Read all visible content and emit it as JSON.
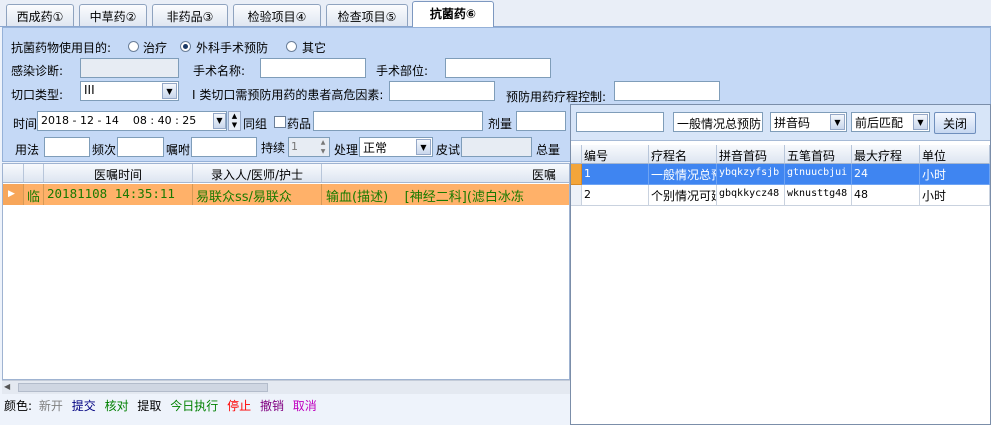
{
  "tabs": [
    "西成药①",
    "中草药②",
    "非药品③",
    "检验项目④",
    "检查项目⑤",
    "抗菌药⑥"
  ],
  "form": {
    "purpose_label": "抗菌药物使用目的:",
    "purpose_options": [
      "治疗",
      "外科手术预防",
      "其它"
    ],
    "purpose_selected": "外科手术预防",
    "infection_label": "感染诊断:",
    "surgery_name_label": "手术名称:",
    "surgery_site_label": "手术部位:",
    "incision_label": "切口类型:",
    "incision_value": "III",
    "risk_label": "I 类切口需预防用药的患者高危因素:",
    "course_control_label": "预防用药疗程控制:",
    "time_label": "时间",
    "time_value": "2018 - 12 - 14    08 : 40 : 25",
    "same_group_label": "同组",
    "drug_label": "药品",
    "dose_label": "剂量",
    "usage_label": "用法",
    "frequency_label": "频次",
    "instruction_label": "嘱咐",
    "duration_label": "持续",
    "duration_value": "1",
    "handle_label": "处理",
    "handle_value": "正常",
    "skin_test_label": "皮试",
    "total_label": "总量"
  },
  "grid": {
    "headers": [
      "医嘱时间",
      "录入人/医师/护士",
      "医嘱"
    ],
    "rows": [
      {
        "type": "临",
        "time": "20181108 14:35:11",
        "staff": "易联众ss/易联众",
        "order": "输血(描述)    [神经二科](滤白冰冻"
      }
    ]
  },
  "legend": {
    "prefix": "颜色:",
    "items": [
      {
        "label": "新开",
        "color": "#808080"
      },
      {
        "label": "提交",
        "color": "#000080"
      },
      {
        "label": "核对",
        "color": "#008000"
      },
      {
        "label": "提取",
        "color": "#000000"
      },
      {
        "label": "今日执行",
        "color": "#008000"
      },
      {
        "label": "停止",
        "color": "#ff0000"
      },
      {
        "label": "撤销",
        "color": "#800080"
      },
      {
        "label": "取消",
        "color": "#c000c0"
      }
    ]
  },
  "popup": {
    "search_value": "",
    "filter_value": "一般情况总预防",
    "code_type": "拼音码",
    "match_mode": "前后匹配",
    "close_label": "关闭",
    "headers": [
      "编号",
      "疗程名",
      "拼音首码",
      "五笔首码",
      "最大疗程",
      "单位"
    ],
    "rows": [
      [
        "1",
        "一般情况总预防",
        "ybqkzyfsjb",
        "gtnuucbjui",
        "24",
        "小时"
      ],
      [
        "2",
        "个别情况可延长",
        "gbqkkycz48",
        "wknusttg48",
        "48",
        "小时"
      ]
    ]
  }
}
